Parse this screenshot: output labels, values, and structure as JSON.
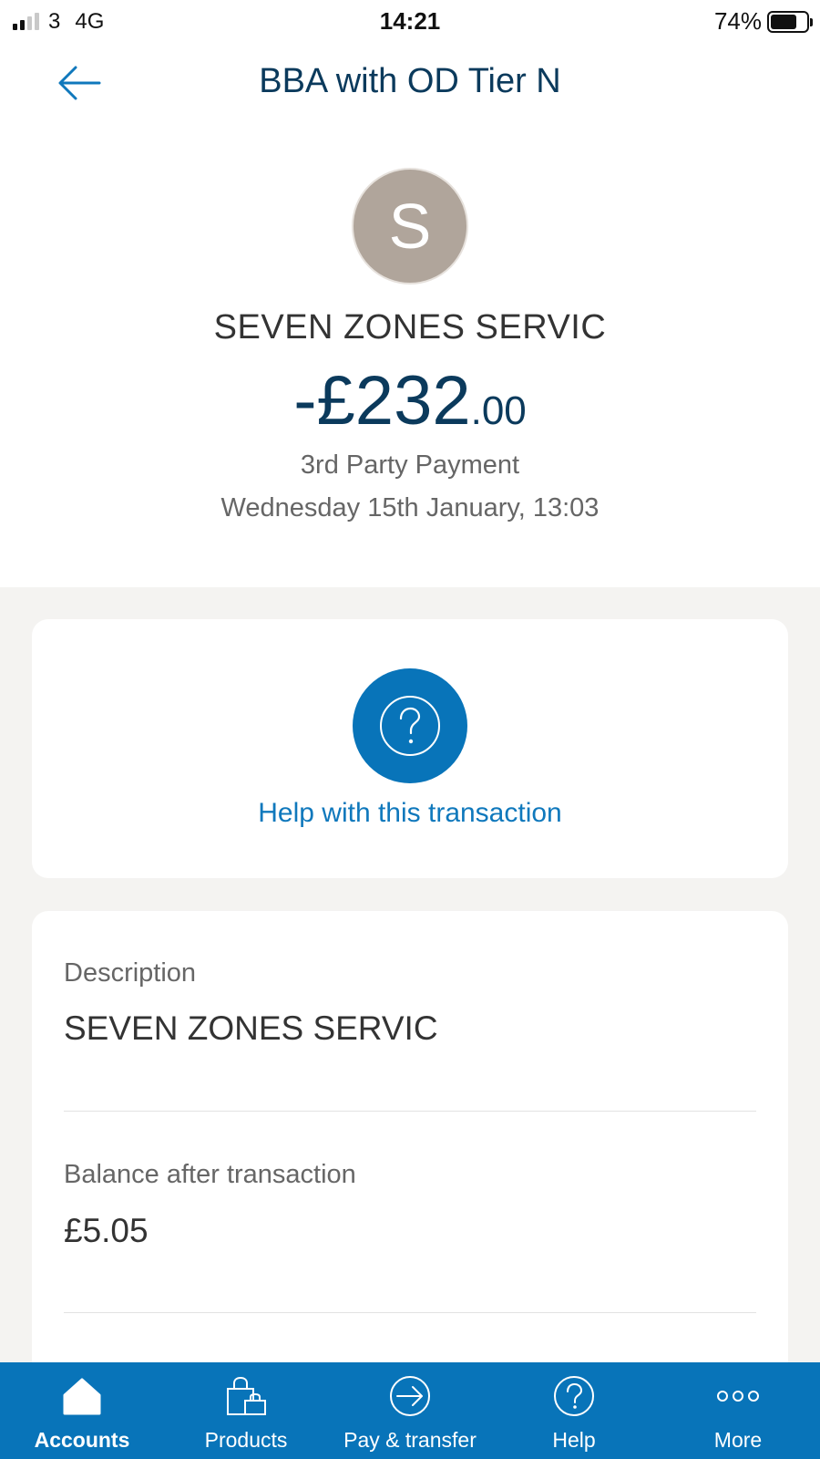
{
  "status_bar": {
    "carrier": "3",
    "network": "4G",
    "time": "14:21",
    "battery_percent": "74%",
    "signal_bars_active": 2,
    "signal_bars_total": 4
  },
  "header": {
    "title": "BBA with OD Tier N",
    "back_icon": "arrow-left-icon"
  },
  "transaction": {
    "avatar_initial": "S",
    "merchant": "SEVEN ZONES SERVIC",
    "amount_main": "-£232",
    "amount_pence": ".00",
    "type": "3rd Party Payment",
    "date": "Wednesday 15th January, 13:03"
  },
  "help_card": {
    "icon": "question-circle-icon",
    "label": "Help with this transaction"
  },
  "details": [
    {
      "label": "Description",
      "value": "SEVEN ZONES SERVIC"
    },
    {
      "label": "Balance after transaction",
      "value": "£5.05"
    }
  ],
  "tab_bar": {
    "tabs": [
      {
        "label": "Accounts",
        "icon": "home-icon",
        "active": true
      },
      {
        "label": "Products",
        "icon": "shopping-bag-icon",
        "active": false
      },
      {
        "label": "Pay & transfer",
        "icon": "arrow-circle-icon",
        "active": false
      },
      {
        "label": "Help",
        "icon": "help-circle-icon",
        "active": false
      },
      {
        "label": "More",
        "icon": "more-dots-icon",
        "active": false
      }
    ]
  },
  "colors": {
    "brand_blue": "#0874b9",
    "navy_text": "#0b3a5c",
    "avatar_bg": "#b0a59b",
    "page_bg": "#f4f3f1"
  }
}
